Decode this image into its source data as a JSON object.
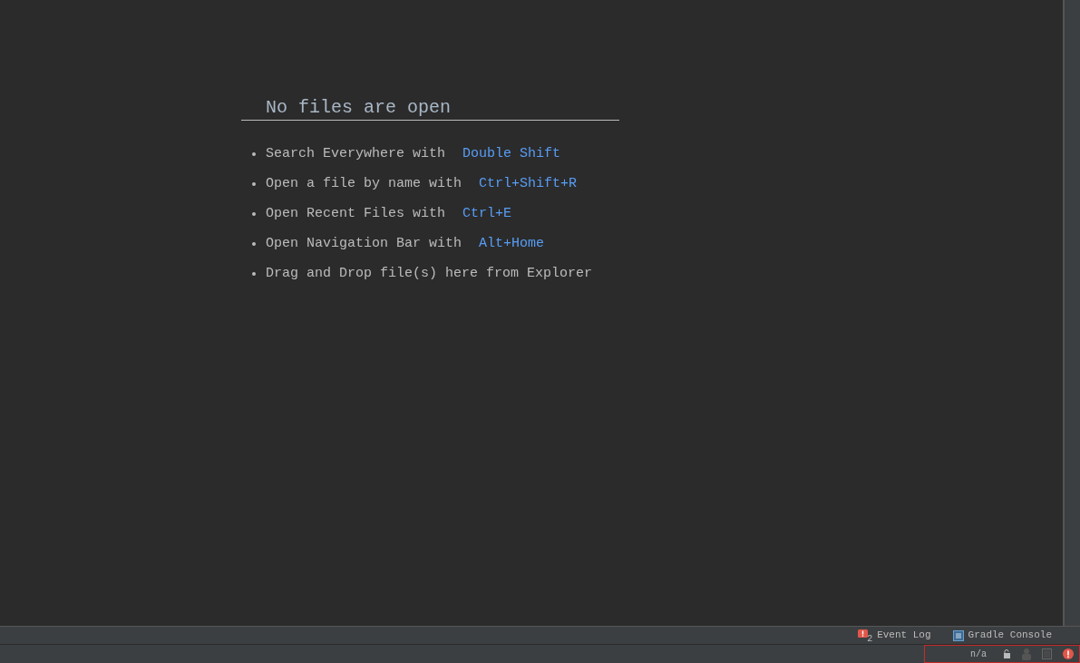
{
  "empty_state": {
    "title": "No files are open",
    "hints": [
      {
        "text": "Search Everywhere with",
        "shortcut": "Double Shift"
      },
      {
        "text": "Open a file by name with",
        "shortcut": "Ctrl+Shift+R"
      },
      {
        "text": "Open Recent Files with",
        "shortcut": "Ctrl+E"
      },
      {
        "text": "Open Navigation Bar with",
        "shortcut": "Alt+Home"
      },
      {
        "text": "Drag and Drop file(s) here from Explorer"
      }
    ]
  },
  "tool_windows": [
    {
      "kind": "event",
      "label": "Event Log",
      "badge": "2"
    },
    {
      "kind": "console",
      "label": "Gradle Console"
    }
  ],
  "status_bar": {
    "position": "n/a"
  }
}
